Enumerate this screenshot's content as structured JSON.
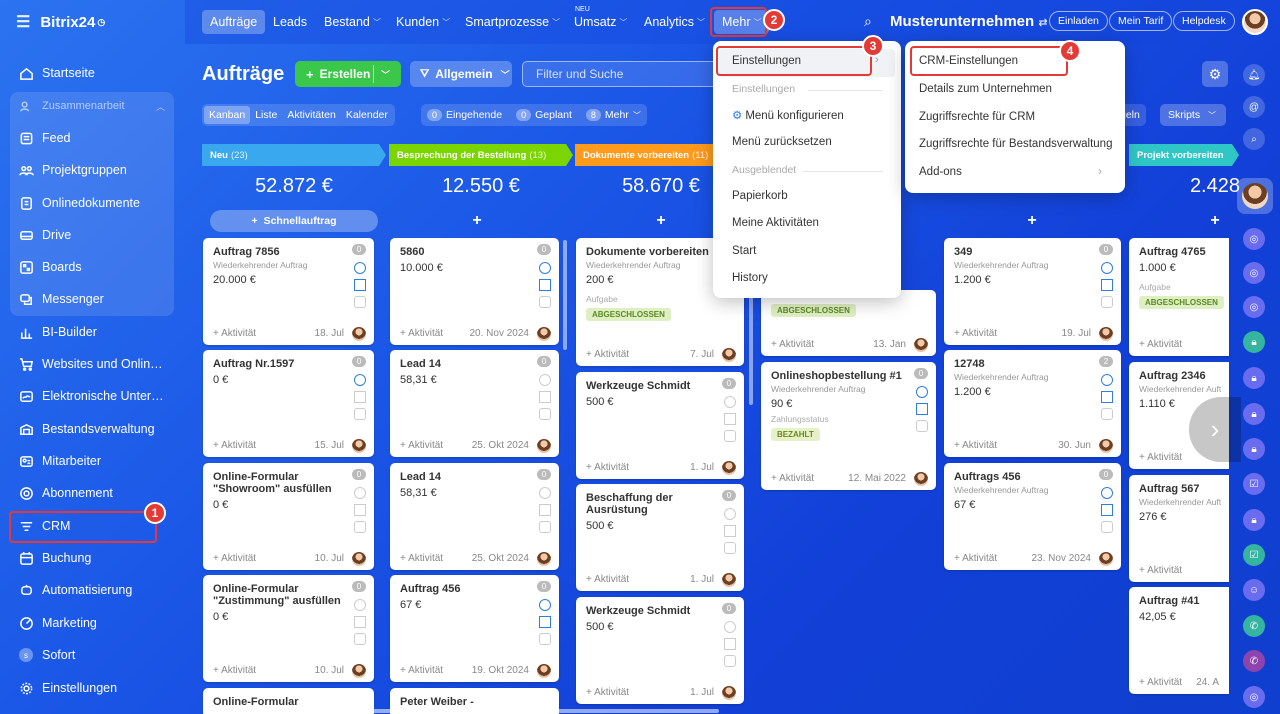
{
  "sidebar": {
    "logo": "Bitrix24",
    "items": [
      {
        "label": "Startseite",
        "icon": "home-icon"
      },
      {
        "label": "Zusammenarbeit",
        "icon": "users-icon"
      },
      {
        "label": "Feed",
        "icon": "feed-icon"
      },
      {
        "label": "Projektgruppen",
        "icon": "group-icon"
      },
      {
        "label": "Onlinedokumente",
        "icon": "document-icon"
      },
      {
        "label": "Drive",
        "icon": "drive-icon"
      },
      {
        "label": "Boards",
        "icon": "board-icon"
      },
      {
        "label": "Messenger",
        "icon": "chat-icon"
      },
      {
        "label": "BI-Builder",
        "icon": "chart-icon"
      },
      {
        "label": "Websites und Onlineshops",
        "icon": "cart-icon"
      },
      {
        "label": "Elektronische Unterschrift",
        "icon": "signature-icon"
      },
      {
        "label": "Bestandsverwaltung",
        "icon": "inventory-icon"
      },
      {
        "label": "Mitarbeiter",
        "icon": "employee-icon"
      },
      {
        "label": "Abonnement",
        "icon": "subscription-icon"
      },
      {
        "label": "CRM",
        "icon": "crm-icon"
      },
      {
        "label": "Buchung",
        "icon": "calendar-icon"
      },
      {
        "label": "Automatisierung",
        "icon": "automation-icon"
      },
      {
        "label": "Marketing",
        "icon": "marketing-icon"
      },
      {
        "label": "Sofort",
        "icon": "sofort-icon"
      },
      {
        "label": "Einstellungen",
        "icon": "gear-icon"
      }
    ]
  },
  "topnav": {
    "items": [
      "Aufträge",
      "Leads",
      "Bestand",
      "Kunden",
      "Smartprozesse",
      "Umsatz",
      "Analytics",
      "Mehr"
    ],
    "neu_label": "NEU",
    "company": "Musterunternehmen",
    "buttons": [
      "Einladen",
      "Mein Tarif",
      "Helpdesk"
    ]
  },
  "toolbar": {
    "title": "Aufträge",
    "create": "Erstellen",
    "filter": "Allgemein",
    "search_placeholder": "Filter und Suche",
    "views": [
      "Kanban",
      "Liste",
      "Aktivitäten",
      "Kalender"
    ],
    "counters": [
      {
        "n": "0",
        "label": "Eingehende"
      },
      {
        "n": "0",
        "label": "Geplant"
      },
      {
        "n": "8",
        "label": "Mehr"
      }
    ],
    "right_partial": "geln",
    "scripts": "Skripts"
  },
  "columns": [
    {
      "title": "Neu",
      "count": "(23)",
      "sum": "52.872 €",
      "color": "#39a8ef"
    },
    {
      "title": "Besprechung der Bestellung",
      "count": "(13)",
      "sum": "12.550 €",
      "color": "#7bd500"
    },
    {
      "title": "Dokumente vorbereiten",
      "count": "(11)",
      "sum": "58.670 €",
      "color": "#ff9a1a"
    },
    {
      "title": "Projekt vorbereiten",
      "count": "",
      "sum": "2.428",
      "color": "#2fc6c6"
    }
  ],
  "quick_order": "Schnellauftrag",
  "cards": {
    "c1": [
      {
        "title": "Auftrag 7856",
        "sub": "Wiederkehrender Auftrag",
        "amount": "20.000 €",
        "date": "18. Jul"
      },
      {
        "title": "Auftrag Nr.1597",
        "sub": "",
        "amount": "0 €",
        "date": "15. Jul"
      },
      {
        "title": "Online-Formular \"Showroom\" ausfüllen",
        "sub": "",
        "amount": "0 €",
        "date": "10. Jul"
      },
      {
        "title": "Online-Formular \"Zustimmung\" ausfüllen",
        "sub": "",
        "amount": "0 €",
        "date": "10. Jul"
      },
      {
        "title": "Online-Formular",
        "sub": "",
        "amount": "",
        "date": ""
      }
    ],
    "c2": [
      {
        "title": "5860",
        "sub": "",
        "amount": "10.000 €",
        "date": "20. Nov 2024"
      },
      {
        "title": "Lead 14",
        "sub": "",
        "amount": "58,31 €",
        "date": "25. Okt 2024"
      },
      {
        "title": "Lead 14",
        "sub": "",
        "amount": "58,31 €",
        "date": "25. Okt 2024"
      },
      {
        "title": "Auftrag 456",
        "sub": "",
        "amount": "67 €",
        "date": "19. Okt 2024"
      },
      {
        "title": "Peter Weiber -",
        "sub": "",
        "amount": "",
        "date": ""
      }
    ],
    "c3": [
      {
        "title": "Dokumente vorbereiten",
        "sub": "Wiederkehrender Auftrag",
        "amount": "200 €",
        "task": "Aufgabe",
        "tag": "ABGESCHLOSSEN",
        "date": "7. Jul"
      },
      {
        "title": "Werkzeuge Schmidt",
        "sub": "",
        "amount": "500 €",
        "date": "1. Jul"
      },
      {
        "title": "Beschaffung der Ausrüstung",
        "sub": "",
        "amount": "500 €",
        "date": "1. Jul"
      },
      {
        "title": "Werkzeuge Schmidt",
        "sub": "",
        "amount": "500 €",
        "date": "1. Jul"
      }
    ],
    "c4": [
      {
        "title": "",
        "tag": "ABGESCHLOSSEN",
        "date": "13. Jan"
      },
      {
        "title": "Onlineshopbestellung #1",
        "sub": "Wiederkehrender Auftrag",
        "amount": "90 €",
        "task": "Zahlungsstatus",
        "tag": "BEZAHLT",
        "date": "12. Mai 2022"
      }
    ],
    "c5": [
      {
        "title": "349",
        "sub": "Wiederkehrender Auftrag",
        "amount": "1.200 €",
        "date": "19. Jul"
      },
      {
        "title": "12748",
        "sub": "Wiederkehrender Auftrag",
        "amount": "1.200 €",
        "date": "30. Jun"
      },
      {
        "title": "Auftrags 456",
        "sub": "Wiederkehrender Auftrag",
        "amount": "67 €",
        "date": "23. Nov 2024"
      }
    ],
    "c6": [
      {
        "title": "Auftrag 4765",
        "sub": "",
        "amount": "1.000 €",
        "task": "Aufgabe",
        "tag": "ABGESCHLOSSEN",
        "date": ""
      },
      {
        "title": "Auftrag 2346",
        "sub": "Wiederkehrender Auft",
        "amount": "1.110 €",
        "date": ""
      },
      {
        "title": "Auftrag 567",
        "sub": "Wiederkehrender Auft",
        "amount": "276 €",
        "date": ""
      },
      {
        "title": "Auftrag #41",
        "sub": "",
        "amount": "42,05 €",
        "date": "24. A"
      }
    ]
  },
  "card_activity": "+ Aktivität",
  "menu": {
    "items": [
      "Einstellungen",
      "Einstellungen",
      "Menü konfigurieren",
      "Menü zurücksetzen",
      "Ausgeblendet",
      "Papierkorb",
      "Meine Aktivitäten",
      "Start",
      "History"
    ]
  },
  "submenu": {
    "items": [
      "CRM-Einstellungen",
      "Details zum Unternehmen",
      "Zugriffsrechte für CRM",
      "Zugriffsrechte für Bestandsverwaltung",
      "Add-ons"
    ]
  },
  "steps": [
    "1",
    "2",
    "3",
    "4"
  ],
  "colors": {
    "accent": "#2fc6c6",
    "highlight": "#e53935",
    "create_green": "#3bc84a"
  }
}
